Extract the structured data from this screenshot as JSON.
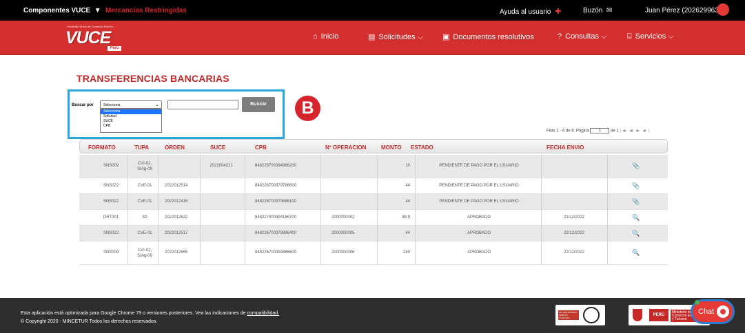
{
  "topbar": {
    "componentes": "Componentes VUCE",
    "mercancias": "Mercancías Restringidas",
    "ayuda": "Ayuda al usuario",
    "buzon": "Buzón",
    "user": "Juan Pérez (20262996329)"
  },
  "header": {
    "logo_tag": "Ventanilla Única de Comercio Exterior",
    "logo_brand": "VUCE",
    "logo_peru": "Perú",
    "nav": [
      {
        "label": "Inicio",
        "icon": "home-icon"
      },
      {
        "label": "Solicitudes",
        "icon": "document-icon"
      },
      {
        "label": "Documentos resolutivos",
        "icon": "file-check-icon"
      },
      {
        "label": "Consultas",
        "icon": "help-icon"
      },
      {
        "label": "Servicios",
        "icon": "services-icon"
      }
    ]
  },
  "page_title": "TRANSFERENCIAS BANCARIAS",
  "search": {
    "label": "Buscar por",
    "selected": "Selecciona",
    "options": [
      "Selecciona",
      "Solicitud",
      "SUCE",
      "CPB"
    ],
    "button": "Buscar",
    "badge": "B"
  },
  "pager": {
    "text": "Filas 1 - 6 de 6.   Página",
    "page": "1",
    "of": "de 1",
    "arrows": "|◀ ◀ ▶ ▶|"
  },
  "table": {
    "headers": [
      "FORMATO",
      "TUPA",
      "ORDEN",
      "SUCE",
      "CPB",
      "Nº OPERACION",
      "MONTO",
      "ESTADO",
      "FECHA ENVIO"
    ],
    "rows": [
      {
        "formato": "SNS009",
        "tupa": "CVI-02, SIAg-09",
        "orden": "",
        "suce": "2022004221",
        "cpb": "848226700394986200",
        "operacion": "",
        "monto": "10",
        "estado": "PENDIENTE DE PAGO POR EL USUARIO",
        "fecha": "",
        "action": "clip-icon"
      },
      {
        "formato": "SNS022",
        "tupa": "CVE-01",
        "orden": "2022012514",
        "suce": "",
        "cpb": "848226700379786800",
        "operacion": "",
        "monto": "44",
        "estado": "PENDIENTE DE PAGO POR EL USUARIO",
        "fecha": "",
        "action": "clip-icon"
      },
      {
        "formato": "SNS022",
        "tupa": "CVE-01",
        "orden": "2022012416",
        "suce": "",
        "cpb": "848226700379686100",
        "operacion": "",
        "monto": "44",
        "estado": "PENDIENTE DE PAGO POR EL USUARIO",
        "fecha": "",
        "action": "clip-icon"
      },
      {
        "formato": "DRT001",
        "tupa": "82",
        "orden": "2022012622",
        "suce": "",
        "cpb": "848227000394186700",
        "operacion": "2000000002",
        "monto": "88.9",
        "estado": "APROBADO",
        "fecha": "21/12/2022",
        "action": "magnifier-icon"
      },
      {
        "formato": "SNS022",
        "tupa": "CVE-01",
        "orden": "2022012517",
        "suce": "",
        "cpb": "848226700379886400",
        "operacion": "2000000005",
        "monto": "44",
        "estado": "APROBADO",
        "fecha": "22/12/2022",
        "action": "magnifier-icon"
      },
      {
        "formato": "SNS009",
        "tupa": "CVI-02, SIAg-09",
        "orden": "2022012655",
        "suce": "",
        "cpb": "848226700394886600",
        "operacion": "2000000006",
        "monto": "240",
        "estado": "APROBADO",
        "fecha": "22/12/2022",
        "action": "magnifier-icon"
      }
    ]
  },
  "footer": {
    "line1_pre": "Esta aplicación está optimizada para Google Chrome 79 o versiones posteriores. Vea las indicaciones de ",
    "line1_link": "compatibilidad.",
    "line2": "© Copyright 2020 - MINCETUR Todos los derechos reservados.",
    "bv_text": "ISO 9001 BUREAU VERITAS Certification",
    "peru": "PERÚ",
    "ministry": "Ministerio de Comercio Exterior y Turismo"
  },
  "chat": {
    "label": "Chat"
  },
  "colors": {
    "brand_red": "#d32f2f",
    "title_red": "#c62828",
    "highlight_blue": "#29a8e0",
    "badge_red": "#d6242d"
  }
}
